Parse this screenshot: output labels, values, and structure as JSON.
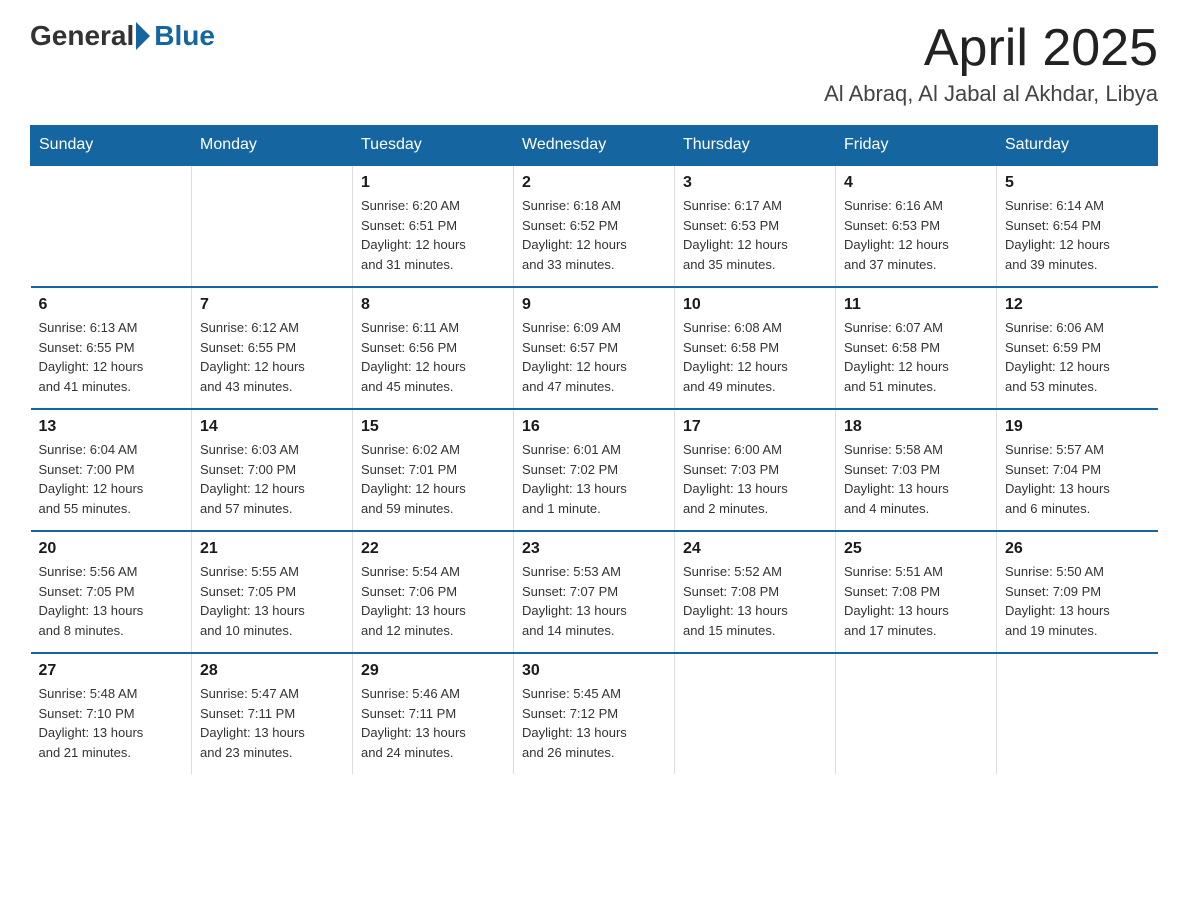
{
  "logo": {
    "general": "General",
    "blue": "Blue"
  },
  "header": {
    "month": "April 2025",
    "location": "Al Abraq, Al Jabal al Akhdar, Libya"
  },
  "days_of_week": [
    "Sunday",
    "Monday",
    "Tuesday",
    "Wednesday",
    "Thursday",
    "Friday",
    "Saturday"
  ],
  "weeks": [
    [
      {
        "day": "",
        "info": ""
      },
      {
        "day": "",
        "info": ""
      },
      {
        "day": "1",
        "info": "Sunrise: 6:20 AM\nSunset: 6:51 PM\nDaylight: 12 hours\nand 31 minutes."
      },
      {
        "day": "2",
        "info": "Sunrise: 6:18 AM\nSunset: 6:52 PM\nDaylight: 12 hours\nand 33 minutes."
      },
      {
        "day": "3",
        "info": "Sunrise: 6:17 AM\nSunset: 6:53 PM\nDaylight: 12 hours\nand 35 minutes."
      },
      {
        "day": "4",
        "info": "Sunrise: 6:16 AM\nSunset: 6:53 PM\nDaylight: 12 hours\nand 37 minutes."
      },
      {
        "day": "5",
        "info": "Sunrise: 6:14 AM\nSunset: 6:54 PM\nDaylight: 12 hours\nand 39 minutes."
      }
    ],
    [
      {
        "day": "6",
        "info": "Sunrise: 6:13 AM\nSunset: 6:55 PM\nDaylight: 12 hours\nand 41 minutes."
      },
      {
        "day": "7",
        "info": "Sunrise: 6:12 AM\nSunset: 6:55 PM\nDaylight: 12 hours\nand 43 minutes."
      },
      {
        "day": "8",
        "info": "Sunrise: 6:11 AM\nSunset: 6:56 PM\nDaylight: 12 hours\nand 45 minutes."
      },
      {
        "day": "9",
        "info": "Sunrise: 6:09 AM\nSunset: 6:57 PM\nDaylight: 12 hours\nand 47 minutes."
      },
      {
        "day": "10",
        "info": "Sunrise: 6:08 AM\nSunset: 6:58 PM\nDaylight: 12 hours\nand 49 minutes."
      },
      {
        "day": "11",
        "info": "Sunrise: 6:07 AM\nSunset: 6:58 PM\nDaylight: 12 hours\nand 51 minutes."
      },
      {
        "day": "12",
        "info": "Sunrise: 6:06 AM\nSunset: 6:59 PM\nDaylight: 12 hours\nand 53 minutes."
      }
    ],
    [
      {
        "day": "13",
        "info": "Sunrise: 6:04 AM\nSunset: 7:00 PM\nDaylight: 12 hours\nand 55 minutes."
      },
      {
        "day": "14",
        "info": "Sunrise: 6:03 AM\nSunset: 7:00 PM\nDaylight: 12 hours\nand 57 minutes."
      },
      {
        "day": "15",
        "info": "Sunrise: 6:02 AM\nSunset: 7:01 PM\nDaylight: 12 hours\nand 59 minutes."
      },
      {
        "day": "16",
        "info": "Sunrise: 6:01 AM\nSunset: 7:02 PM\nDaylight: 13 hours\nand 1 minute."
      },
      {
        "day": "17",
        "info": "Sunrise: 6:00 AM\nSunset: 7:03 PM\nDaylight: 13 hours\nand 2 minutes."
      },
      {
        "day": "18",
        "info": "Sunrise: 5:58 AM\nSunset: 7:03 PM\nDaylight: 13 hours\nand 4 minutes."
      },
      {
        "day": "19",
        "info": "Sunrise: 5:57 AM\nSunset: 7:04 PM\nDaylight: 13 hours\nand 6 minutes."
      }
    ],
    [
      {
        "day": "20",
        "info": "Sunrise: 5:56 AM\nSunset: 7:05 PM\nDaylight: 13 hours\nand 8 minutes."
      },
      {
        "day": "21",
        "info": "Sunrise: 5:55 AM\nSunset: 7:05 PM\nDaylight: 13 hours\nand 10 minutes."
      },
      {
        "day": "22",
        "info": "Sunrise: 5:54 AM\nSunset: 7:06 PM\nDaylight: 13 hours\nand 12 minutes."
      },
      {
        "day": "23",
        "info": "Sunrise: 5:53 AM\nSunset: 7:07 PM\nDaylight: 13 hours\nand 14 minutes."
      },
      {
        "day": "24",
        "info": "Sunrise: 5:52 AM\nSunset: 7:08 PM\nDaylight: 13 hours\nand 15 minutes."
      },
      {
        "day": "25",
        "info": "Sunrise: 5:51 AM\nSunset: 7:08 PM\nDaylight: 13 hours\nand 17 minutes."
      },
      {
        "day": "26",
        "info": "Sunrise: 5:50 AM\nSunset: 7:09 PM\nDaylight: 13 hours\nand 19 minutes."
      }
    ],
    [
      {
        "day": "27",
        "info": "Sunrise: 5:48 AM\nSunset: 7:10 PM\nDaylight: 13 hours\nand 21 minutes."
      },
      {
        "day": "28",
        "info": "Sunrise: 5:47 AM\nSunset: 7:11 PM\nDaylight: 13 hours\nand 23 minutes."
      },
      {
        "day": "29",
        "info": "Sunrise: 5:46 AM\nSunset: 7:11 PM\nDaylight: 13 hours\nand 24 minutes."
      },
      {
        "day": "30",
        "info": "Sunrise: 5:45 AM\nSunset: 7:12 PM\nDaylight: 13 hours\nand 26 minutes."
      },
      {
        "day": "",
        "info": ""
      },
      {
        "day": "",
        "info": ""
      },
      {
        "day": "",
        "info": ""
      }
    ]
  ]
}
